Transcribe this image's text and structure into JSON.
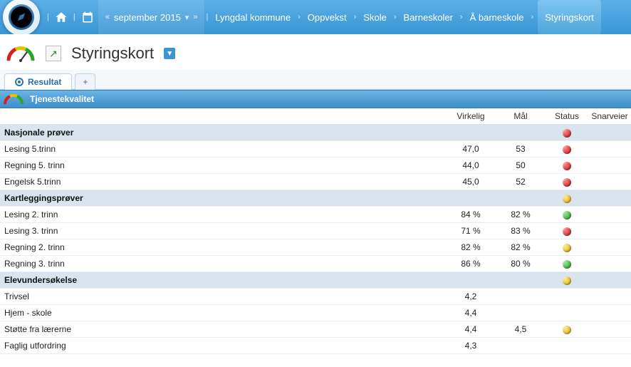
{
  "topbar": {
    "period": "september 2015",
    "crumbs": [
      "Lyngdal kommune",
      "Oppvekst",
      "Skole",
      "Barneskoler",
      "Å barneskole"
    ],
    "last": "Styringskort"
  },
  "page": {
    "title": "Styringskort"
  },
  "tabs": {
    "active": "Resultat",
    "add": "+"
  },
  "section": {
    "title": "Tjenestekvalitet"
  },
  "columns": {
    "virkelig": "Virkelig",
    "maal": "Mål",
    "status": "Status",
    "snarveier": "Snarveier"
  },
  "rows": [
    {
      "type": "group",
      "label": "Nasjonale prøver",
      "status": "red"
    },
    {
      "type": "item",
      "label": "Lesing 5.trinn",
      "virkelig": "47,0",
      "maal": "53",
      "status": "red"
    },
    {
      "type": "item",
      "label": "Regning 5. trinn",
      "virkelig": "44,0",
      "maal": "50",
      "status": "red"
    },
    {
      "type": "item",
      "label": "Engelsk 5.trinn",
      "virkelig": "45,0",
      "maal": "52",
      "status": "red"
    },
    {
      "type": "group",
      "label": "Kartleggingsprøver",
      "status": "yellow"
    },
    {
      "type": "item",
      "label": "Lesing 2. trinn",
      "virkelig": "84  %",
      "maal": "82  %",
      "status": "green"
    },
    {
      "type": "item",
      "label": "Lesing 3. trinn",
      "virkelig": "71  %",
      "maal": "83  %",
      "status": "red"
    },
    {
      "type": "item",
      "label": "Regning 2. trinn",
      "virkelig": "82  %",
      "maal": "82  %",
      "status": "yellow"
    },
    {
      "type": "item",
      "label": "Regning 3. trinn",
      "virkelig": "86  %",
      "maal": "80  %",
      "status": "green"
    },
    {
      "type": "group",
      "label": "Elevundersøkelse",
      "status": "yellow"
    },
    {
      "type": "item",
      "label": "Trivsel",
      "virkelig": "4,2",
      "maal": "",
      "status": ""
    },
    {
      "type": "item",
      "label": "Hjem - skole",
      "virkelig": "4,4",
      "maal": "",
      "status": ""
    },
    {
      "type": "item",
      "label": "Støtte fra lærerne",
      "virkelig": "4,4",
      "maal": "4,5",
      "status": "yellow"
    },
    {
      "type": "item",
      "label": "Faglig utfordring",
      "virkelig": "4,3",
      "maal": "",
      "status": ""
    }
  ]
}
